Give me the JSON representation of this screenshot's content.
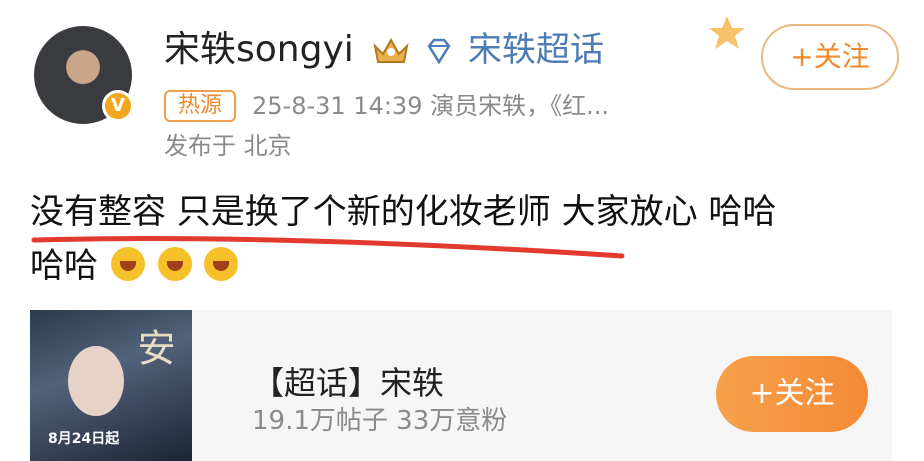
{
  "user": {
    "name": "宋轶songyi",
    "topic_label": "宋轶超话",
    "hot_tag": "热源",
    "meta_line1": "25-8-31 14:39  演员宋轶，《红...",
    "meta_line2": "发布于 北京"
  },
  "follow_top_label": "+关注",
  "post": {
    "line1": "没有整容 只是换了个新的化妆老师 大家放心 哈哈",
    "line2": "哈哈"
  },
  "card": {
    "title": "【超话】宋轶",
    "subtitle": "19.1万帖子 33万意粉",
    "follow_label": "+关注",
    "poster_title": "与晋长安",
    "poster_date": "8月24日起"
  },
  "colors": {
    "accent": "#f08a2a",
    "link": "#4d7bb3"
  }
}
